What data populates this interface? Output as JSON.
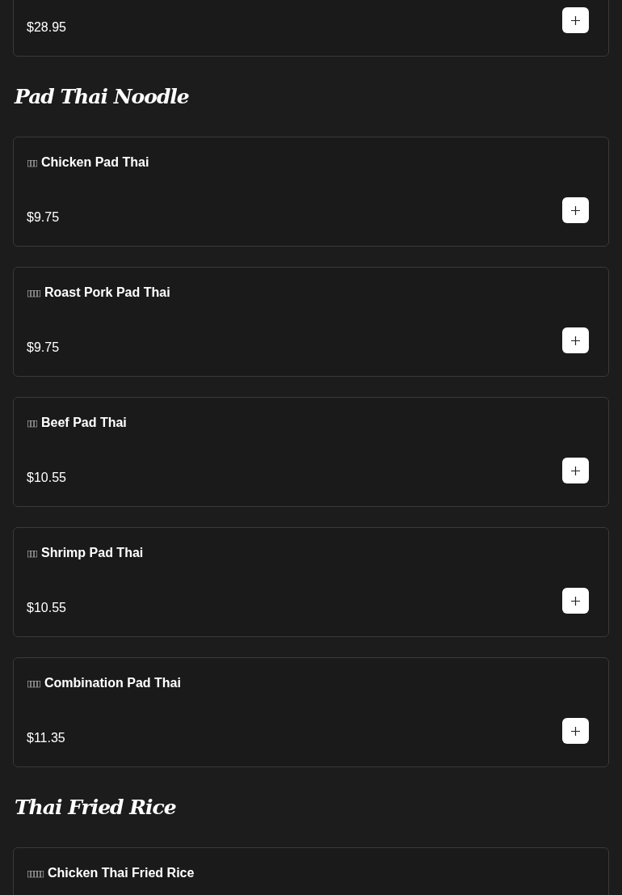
{
  "sections": [
    {
      "items": [
        {
          "price": "$28.95"
        }
      ]
    },
    {
      "title": "Pad Thai Noodle",
      "items": [
        {
          "glyphs": "▯▯▯",
          "name": "Chicken Pad Thai",
          "price": "$9.75"
        },
        {
          "glyphs": "▯▯▯▯",
          "name": "Roast Pork Pad Thai",
          "price": "$9.75"
        },
        {
          "glyphs": "▯▯▯",
          "name": "Beef Pad Thai",
          "price": "$10.55"
        },
        {
          "glyphs": "▯▯▯",
          "name": "Shrimp Pad Thai",
          "price": "$10.55"
        },
        {
          "glyphs": "▯▯▯▯",
          "name": "Combination Pad Thai",
          "price": "$11.35"
        }
      ]
    },
    {
      "title": "Thai Fried Rice",
      "items": [
        {
          "glyphs": "▯▯▯▯▯",
          "name": "Chicken Thai Fried Rice"
        }
      ]
    }
  ]
}
